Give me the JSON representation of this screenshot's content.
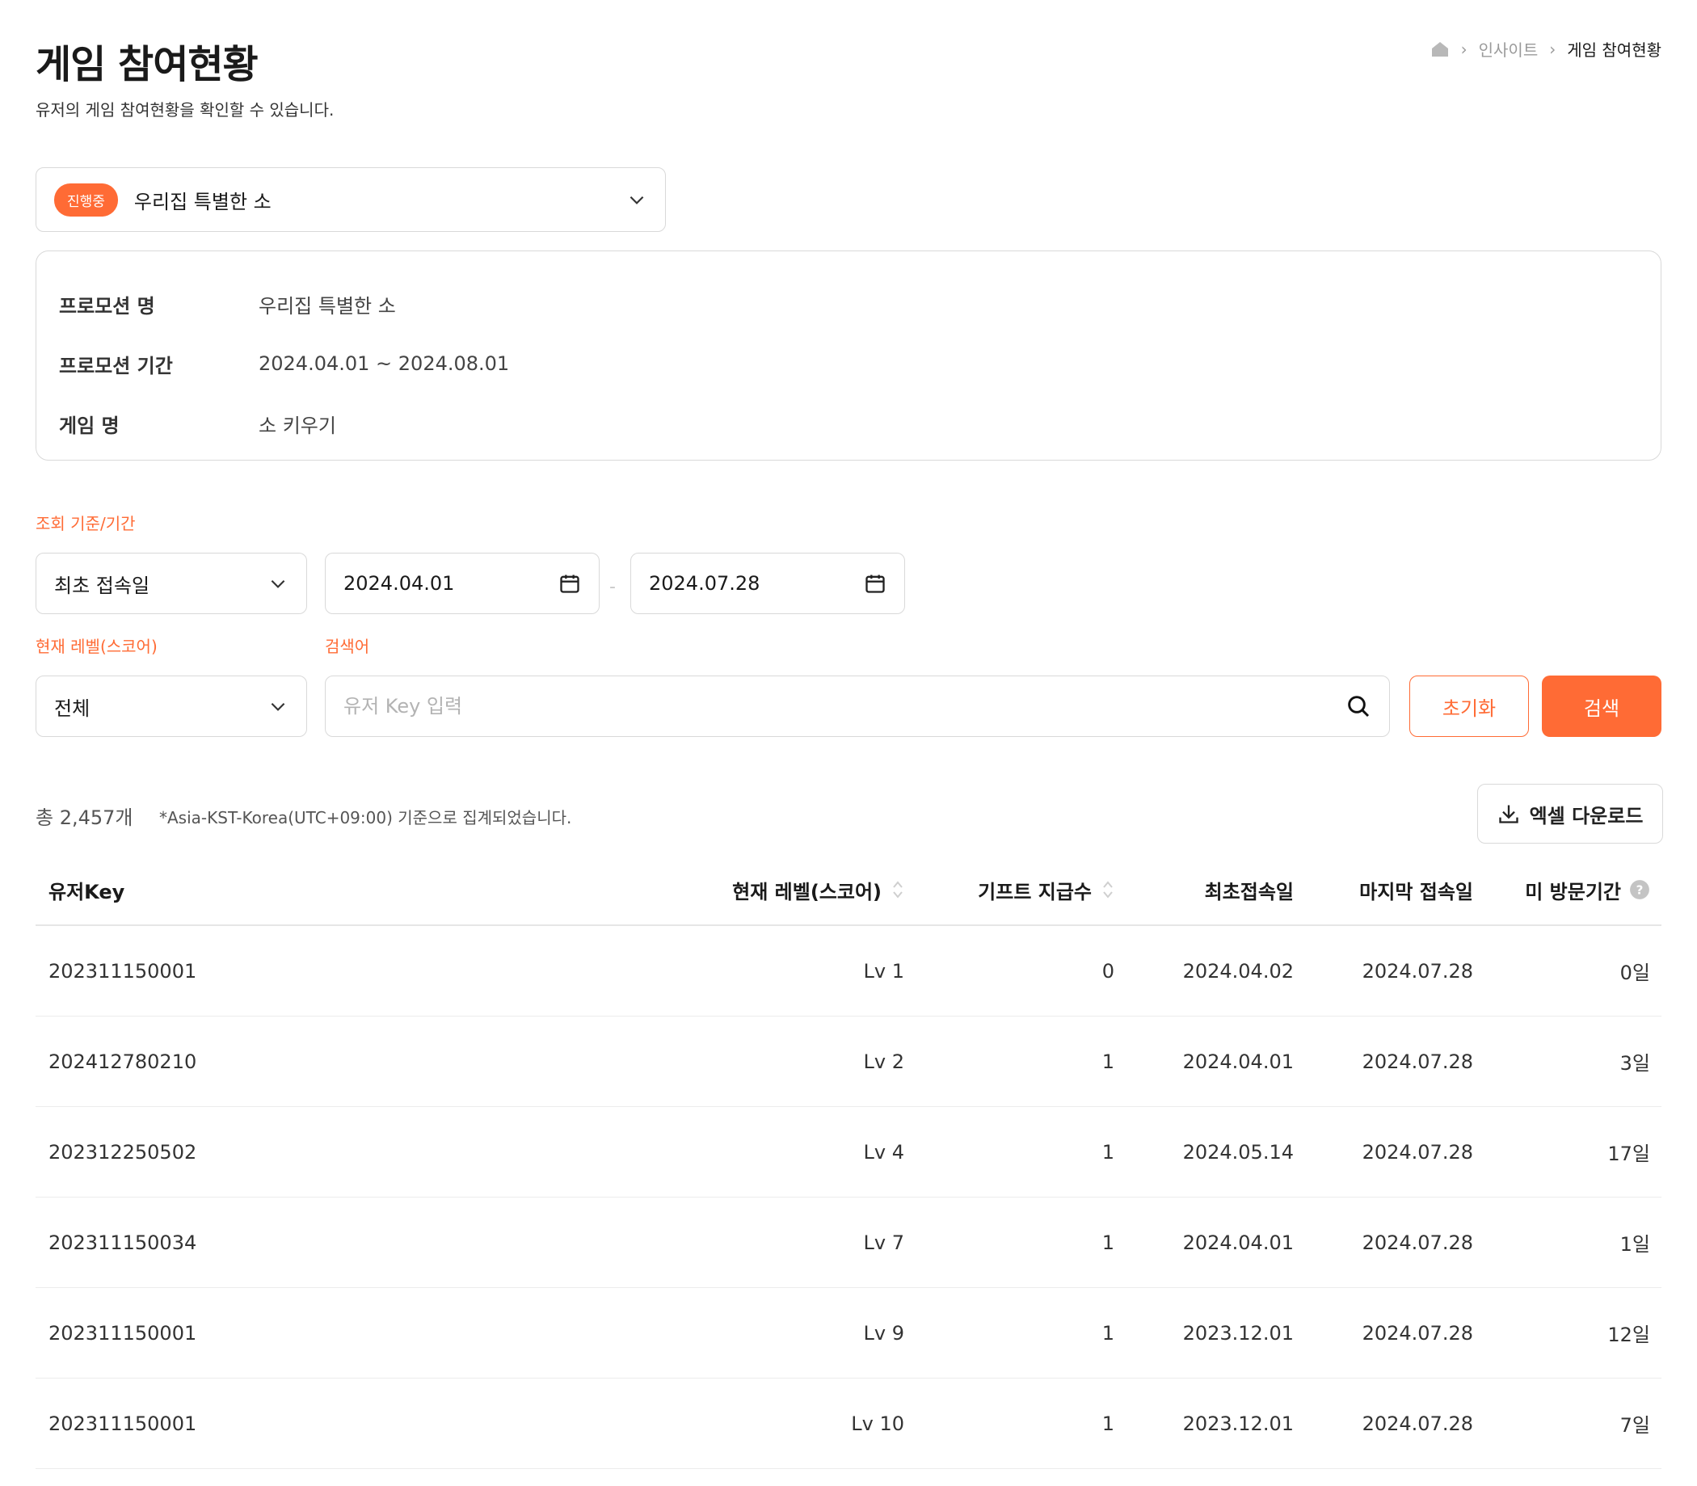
{
  "header": {
    "title": "게임 참여현황",
    "subtitle": "유저의 게임 참여현황을 확인할 수 있습니다.",
    "breadcrumb": [
      "인사이트",
      "게임 참여현황"
    ]
  },
  "promotion_select": {
    "status": "진행중",
    "name": "우리집 특별한 소"
  },
  "info": {
    "rows": [
      {
        "label": "프로모션 명",
        "value": "우리집 특별한 소"
      },
      {
        "label": "프로모션 기간",
        "value": "2024.04.01 ~ 2024.08.01"
      },
      {
        "label": "게임 명",
        "value": "소 키우기"
      }
    ]
  },
  "filters": {
    "period_label": "조회 기준/기간",
    "period_type": "최초 접속일",
    "start_date": "2024.04.01",
    "end_date": "2024.07.28",
    "date_separator": "-",
    "level_label": "현재 레벨(스코어)",
    "level_value": "전체",
    "keyword_label": "검색어",
    "keyword_placeholder": "유저 Key 입력",
    "reset_label": "초기화",
    "search_label": "검색"
  },
  "summary": {
    "total": "총 2,457개",
    "note": "*Asia-KST-Korea(UTC+09:00) 기준으로 집계되었습니다.",
    "excel_label": "엑셀 다운로드"
  },
  "table": {
    "columns": [
      "유저Key",
      "현재 레벨(스코어)",
      "기프트 지급수",
      "최초접속일",
      "마지막 접속일",
      "미 방문기간"
    ],
    "rows": [
      [
        "202311150001",
        "Lv 1",
        "0",
        "2024.04.02",
        "2024.07.28",
        "0일"
      ],
      [
        "202412780210",
        "Lv 2",
        "1",
        "2024.04.01",
        "2024.07.28",
        "3일"
      ],
      [
        "202312250502",
        "Lv 4",
        "1",
        "2024.05.14",
        "2024.07.28",
        "17일"
      ],
      [
        "202311150034",
        "Lv 7",
        "1",
        "2024.04.01",
        "2024.07.28",
        "1일"
      ],
      [
        "202311150001",
        "Lv 9",
        "1",
        "2023.12.01",
        "2024.07.28",
        "12일"
      ],
      [
        "202311150001",
        "Lv 10",
        "1",
        "2023.12.01",
        "2024.07.28",
        "7일"
      ]
    ]
  },
  "colors": {
    "accent": "#ff6b35",
    "border": "#d9d9d9",
    "muted": "#9a9a9a"
  }
}
